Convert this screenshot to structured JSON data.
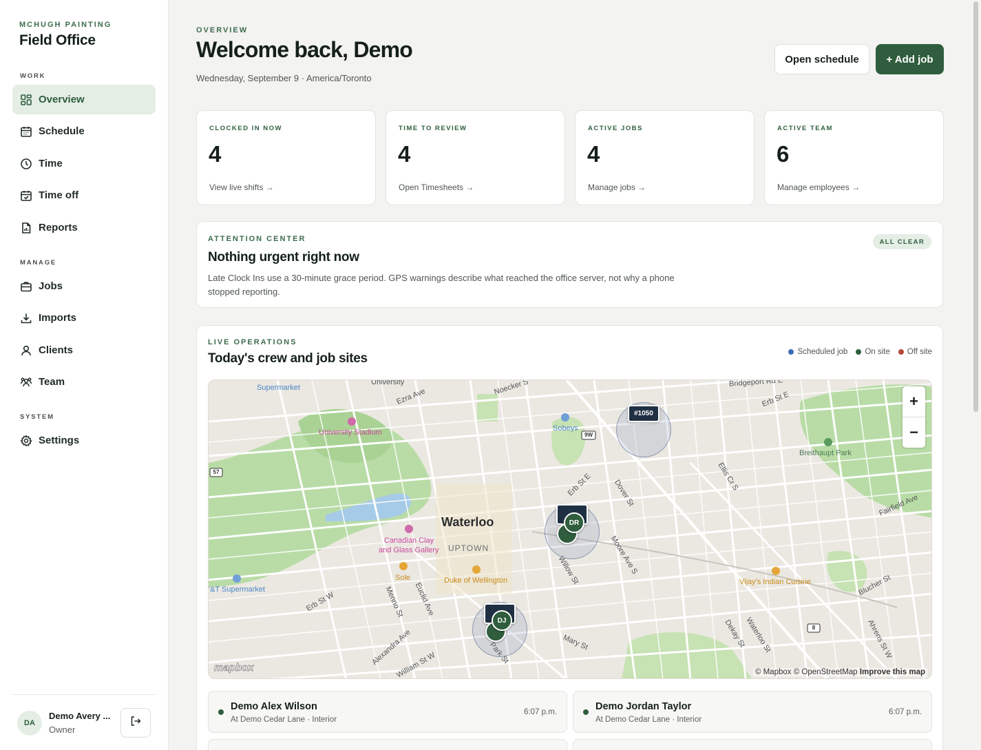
{
  "sidebar": {
    "brand_kicker": "MCHUGH PAINTING",
    "brand_title": "Field Office",
    "sections": {
      "work": "WORK",
      "manage": "MANAGE",
      "system": "SYSTEM"
    },
    "items": [
      {
        "label": "Overview",
        "icon": "grid-icon",
        "active": true
      },
      {
        "label": "Schedule",
        "icon": "calendar-icon"
      },
      {
        "label": "Time",
        "icon": "clock-icon"
      },
      {
        "label": "Time off",
        "icon": "calendar-check-icon"
      },
      {
        "label": "Reports",
        "icon": "report-icon"
      },
      {
        "label": "Jobs",
        "icon": "briefcase-icon"
      },
      {
        "label": "Imports",
        "icon": "download-icon"
      },
      {
        "label": "Clients",
        "icon": "user-icon"
      },
      {
        "label": "Team",
        "icon": "team-icon"
      },
      {
        "label": "Settings",
        "icon": "gear-icon"
      }
    ],
    "user": {
      "initials": "DA",
      "name": "Demo Avery ...",
      "role": "Owner"
    }
  },
  "header": {
    "kicker": "OVERVIEW",
    "title": "Welcome back, Demo",
    "subtitle": "Wednesday, September 9 · America/Toronto",
    "open_schedule": "Open schedule",
    "add_job": "+ Add job"
  },
  "stats": [
    {
      "label": "CLOCKED IN NOW",
      "value": "4",
      "link": "View live shifts →"
    },
    {
      "label": "TIME TO REVIEW",
      "value": "4",
      "link": "Open Timesheets →"
    },
    {
      "label": "ACTIVE JOBS",
      "value": "4",
      "link": "Manage jobs →"
    },
    {
      "label": "ACTIVE TEAM",
      "value": "6",
      "link": "Manage employees →"
    }
  ],
  "attention": {
    "kicker": "ATTENTION CENTER",
    "title": "Nothing urgent right now",
    "body": "Late Clock Ins use a 30-minute grace period. GPS warnings describe what reached the office server, not why a phone stopped reporting.",
    "badge": "ALL CLEAR"
  },
  "live": {
    "kicker": "LIVE OPERATIONS",
    "title": "Today's crew and job sites",
    "legend": [
      {
        "label": "Scheduled job",
        "color": "#3b6fb5"
      },
      {
        "label": "On site",
        "color": "#2f5d3d"
      },
      {
        "label": "Off site",
        "color": "#b5483b"
      }
    ],
    "map": {
      "zoom_in": "+",
      "zoom_out": "−",
      "attribution_a": "© Mapbox © OpenStreetMap",
      "attribution_b": "Improve this map",
      "logo": "mapbox",
      "pin_job": "#1050",
      "crew_dr": "DR",
      "crew_dj": "DJ",
      "labels": {
        "waterloo": "Waterloo",
        "uptown": "UPTOWN",
        "university_stadium": "University Stadium",
        "sobeys": "Sobeys",
        "breithaupt": "Breithaupt Park",
        "canadian_clay": "Canadian Clay",
        "glass_gallery": "and Glass Gallery",
        "sole": "Sole",
        "duke": "Duke of Wellington",
        "vijays": "Vijay's Indian Cuisine",
        "supermarket_top": "Supermarket",
        "supermarket_left": "'&T Supermarket",
        "university": "University",
        "erb_st_e": "Erb St E",
        "erb_st_e2": "Erb St E",
        "erb_st_w": "Erb St W",
        "ezra_ave": "Ezra Ave",
        "noecker": "Noecker S",
        "bridgeport": "Bridgeport Rd E",
        "dover_st": "Dover St",
        "ellis_cr": "Ellis Cr S",
        "moore_ave": "Moore Ave S",
        "willow_st": "Willow St",
        "fairfield": "Fairfield Ave",
        "blucher": "Blucher St",
        "menno": "Menno St",
        "euclid": "Euclid Ave",
        "alexandra": "Alexandra Ave",
        "william": "William St W",
        "park_st": "Park St",
        "mary_st": "Mary St",
        "dekay": "Dekay St",
        "waterloo_st": "Waterloo St",
        "ahrens": "Ahrens St W",
        "r57": "57",
        "r9w": "9W",
        "r8": "8"
      }
    },
    "shifts": [
      {
        "name": "Demo Alex Wilson",
        "location": "At Demo Cedar Lane · Interior",
        "time": "6:07 p.m."
      },
      {
        "name": "Demo Jordan Taylor",
        "location": "At Demo Cedar Lane · Interior",
        "time": "6:07 p.m."
      }
    ]
  }
}
